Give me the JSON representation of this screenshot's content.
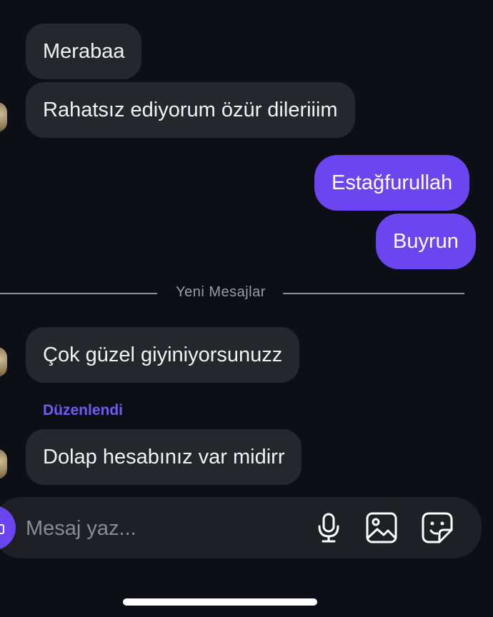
{
  "messages": [
    {
      "id": 1,
      "direction": "incoming",
      "text": "Merabaa"
    },
    {
      "id": 2,
      "direction": "incoming",
      "text": "Rahatsız ediyorum özür dileriiim"
    },
    {
      "id": 3,
      "direction": "outgoing",
      "text": "Estağfurullah"
    },
    {
      "id": 4,
      "direction": "outgoing",
      "text": "Buyrun"
    },
    {
      "id": 5,
      "direction": "incoming",
      "text": "Çok güzel giyiniyorsunuzz"
    },
    {
      "id": 6,
      "direction": "incoming",
      "text": "Dolap hesabınız var midirr",
      "edited_label": "Düzenlendi"
    }
  ],
  "divider": {
    "label": "Yeni Mesajlar"
  },
  "composer": {
    "placeholder": "Mesaj yaz...",
    "value": "",
    "icons": [
      "camera-icon",
      "microphone-icon",
      "image-icon",
      "sticker-icon"
    ]
  },
  "colors": {
    "background": "#0c0f16",
    "incoming_bubble": "#25272d",
    "outgoing_bubble": "#6a45f0",
    "edited_label": "#6d5cf5",
    "composer_background": "#1e2026"
  }
}
